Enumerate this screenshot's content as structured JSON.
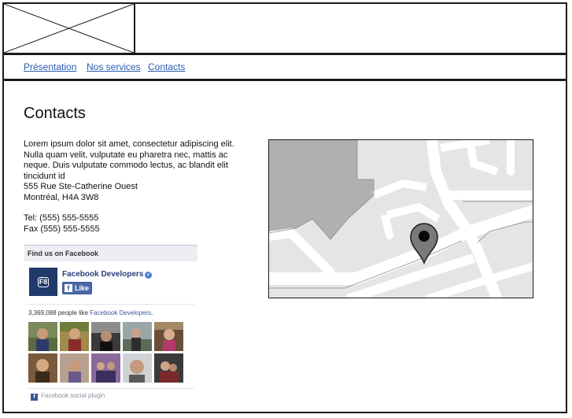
{
  "nav": {
    "items": [
      {
        "label": "Présentation"
      },
      {
        "label": "Nos services"
      },
      {
        "label": "Contacts"
      }
    ]
  },
  "page": {
    "title": "Contacts",
    "intro": "Lorem ipsum dolor sit amet, consectetur adipiscing elit. Nulla quam velit, vulputate eu pharetra nec, mattis ac neque. Duis vulputate commodo lectus, ac blandit elit tincidunt id",
    "address_line1": "555 Rue Ste-Catherine Ouest",
    "address_line2": "Montréal, H4A 3W8",
    "phone": "Tel: (555) 555-5555",
    "fax": "Fax (555) 555-5555"
  },
  "facebook": {
    "header": "Find us on Facebook",
    "avatar_text": "F8",
    "page_name": "Facebook Developers",
    "verified_icon": "check-badge-icon",
    "like_label": "Like",
    "like_count": "3,369,088",
    "like_text": " people like ",
    "like_page": "Facebook Developers",
    "like_end": ".",
    "footer": "Facebook social plugin"
  },
  "colors": {
    "link": "#2a5db0",
    "facebook_blue": "#3b5998"
  }
}
